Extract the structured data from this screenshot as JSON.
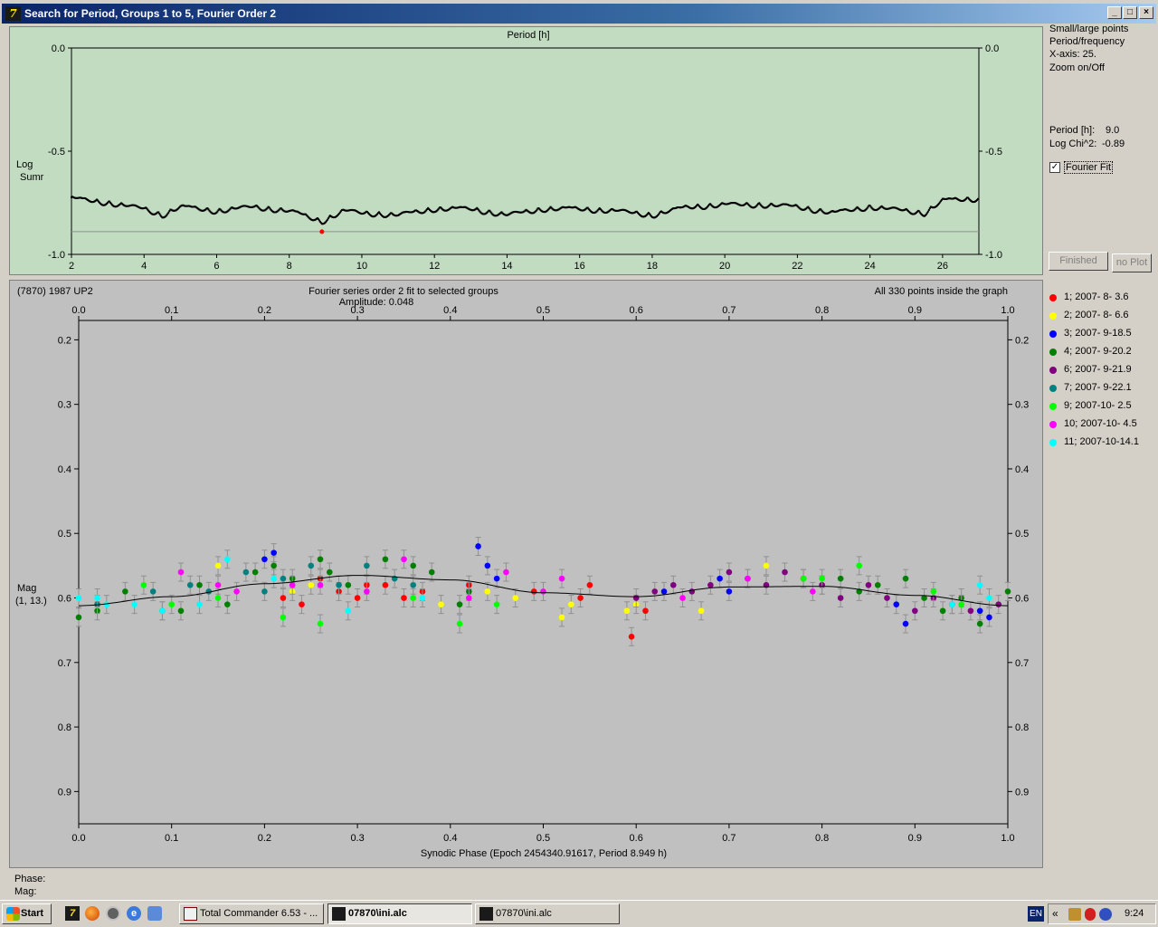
{
  "window": {
    "title": "Search for Period, Groups 1 to 5, Fourier Order 2",
    "min": "_",
    "max": "□",
    "close": "×"
  },
  "periodogram": {
    "xlabel": "Period [h]",
    "ylabel_line1": "Log",
    "ylabel_line2": "Sumr",
    "x_ticks": [
      "2",
      "4",
      "6",
      "8",
      "10",
      "12",
      "14",
      "16",
      "18",
      "20",
      "22",
      "24",
      "26"
    ],
    "y_ticks": [
      "0.0",
      "-0.5",
      "-1.0"
    ]
  },
  "right_panel": {
    "opt1": "Small/large points",
    "opt2": "Period/frequency",
    "opt3": "X-axis: 25.",
    "opt4": "Zoom on/Off",
    "period_label": "Period [h]:",
    "period_value": "9.0",
    "chi_label": "Log Chi^2:",
    "chi_value": "-0.89",
    "checkbox_mark": "✓",
    "fourier_fit": "Fourier Fit",
    "finished": "Finished",
    "no_plot": "no Plot"
  },
  "lightcurve": {
    "object": "(7870) 1987 UP2",
    "fit_title": "Fourier series order 2 fit to selected groups",
    "amplitude": "Amplitude: 0.048",
    "points_note": "All 330 points inside the graph",
    "ylabel_line1": "Mag",
    "ylabel_line2": "(1, 13.)",
    "xlabel": "Synodic Phase (Epoch 2454340.91617, Period 8.949 h)",
    "x_ticks": [
      "0.0",
      "0.1",
      "0.2",
      "0.3",
      "0.4",
      "0.5",
      "0.6",
      "0.7",
      "0.8",
      "0.9",
      "1.0"
    ],
    "y_ticks": [
      "0.2",
      "0.3",
      "0.4",
      "0.5",
      "0.6",
      "0.7",
      "0.8",
      "0.9"
    ]
  },
  "legend": [
    {
      "label": "1; 2007- 8- 3.6",
      "color": "#ff0000"
    },
    {
      "label": "2; 2007- 8- 6.6",
      "color": "#ffff00"
    },
    {
      "label": "3; 2007- 9-18.5",
      "color": "#0000ff"
    },
    {
      "label": "4; 2007- 9-20.2",
      "color": "#008000"
    },
    {
      "label": "6; 2007- 9-21.9",
      "color": "#800080"
    },
    {
      "label": "7; 2007- 9-22.1",
      "color": "#008080"
    },
    {
      "label": "9; 2007-10- 2.5",
      "color": "#00ff00"
    },
    {
      "label": "10; 2007-10- 4.5",
      "color": "#ff00ff"
    },
    {
      "label": "11; 2007-10-14.1",
      "color": "#00ffff"
    }
  ],
  "status": {
    "phase_label": "Phase:",
    "mag_label": "Mag:"
  },
  "taskbar": {
    "start": "Start",
    "task1": "Total Commander 6.53 - ...",
    "task2": "07870\\ini.alc",
    "task3": "07870\\ini.alc",
    "lang": "EN",
    "clock": "9:24",
    "chevron": "«"
  },
  "chart_data": [
    {
      "type": "scatter",
      "title": "",
      "xlabel": "Period [h]",
      "ylabel": "Log Sumr",
      "xlim": [
        2,
        27
      ],
      "ylim": [
        -1.0,
        0.0
      ],
      "x": [
        2,
        3,
        4,
        4.5,
        5,
        6,
        7,
        8,
        8.9,
        9.5,
        10,
        11,
        12,
        13,
        14,
        15,
        16,
        17,
        18,
        19,
        20,
        21,
        22,
        23,
        24,
        25,
        25.5,
        26,
        27
      ],
      "y": [
        -0.72,
        -0.74,
        -0.77,
        -0.8,
        -0.76,
        -0.78,
        -0.76,
        -0.78,
        -0.83,
        -0.78,
        -0.79,
        -0.8,
        -0.77,
        -0.77,
        -0.8,
        -0.77,
        -0.77,
        -0.78,
        -0.8,
        -0.76,
        -0.75,
        -0.75,
        -0.76,
        -0.79,
        -0.76,
        -0.78,
        -0.79,
        -0.73,
        -0.72
      ],
      "best": {
        "x": 8.9,
        "y": -0.89
      },
      "threshold": -0.89
    },
    {
      "type": "scatter",
      "title": "Fourier series order 2 fit to selected groups",
      "xlabel": "Synodic Phase (Epoch 2454340.91617, Period 8.949 h)",
      "ylabel": "Mag",
      "xlim": [
        0,
        1
      ],
      "ylim": [
        0.95,
        0.17
      ],
      "fit": {
        "x": [
          0,
          0.1,
          0.2,
          0.3,
          0.4,
          0.5,
          0.6,
          0.7,
          0.8,
          0.9,
          1.0
        ],
        "y": [
          0.612,
          0.598,
          0.578,
          0.565,
          0.572,
          0.592,
          0.598,
          0.583,
          0.582,
          0.596,
          0.612
        ]
      },
      "series": [
        {
          "name": "1; 2007- 8- 3.6",
          "x": [
            0.22,
            0.24,
            0.26,
            0.28,
            0.3,
            0.31,
            0.33,
            0.35,
            0.37,
            0.42,
            0.49,
            0.54,
            0.55,
            0.595,
            0.61
          ],
          "y": [
            0.6,
            0.61,
            0.57,
            0.59,
            0.6,
            0.58,
            0.58,
            0.6,
            0.59,
            0.58,
            0.59,
            0.6,
            0.58,
            0.66,
            0.62
          ]
        },
        {
          "name": "2; 2007- 8- 6.6",
          "x": [
            0.15,
            0.23,
            0.25,
            0.39,
            0.44,
            0.47,
            0.52,
            0.53,
            0.59,
            0.6,
            0.67,
            0.74,
            0.78
          ],
          "y": [
            0.55,
            0.59,
            0.58,
            0.61,
            0.59,
            0.6,
            0.63,
            0.61,
            0.62,
            0.61,
            0.62,
            0.55,
            0.57
          ]
        },
        {
          "name": "3; 2007- 9-18.5",
          "x": [
            0.2,
            0.21,
            0.43,
            0.44,
            0.45,
            0.63,
            0.69,
            0.7,
            0.88,
            0.89,
            0.97,
            0.98
          ],
          "y": [
            0.54,
            0.53,
            0.52,
            0.55,
            0.57,
            0.59,
            0.57,
            0.59,
            0.61,
            0.64,
            0.62,
            0.63
          ]
        },
        {
          "name": "4; 2007- 9-20.2",
          "x": [
            0.0,
            0.02,
            0.05,
            0.09,
            0.11,
            0.13,
            0.16,
            0.19,
            0.21,
            0.23,
            0.26,
            0.27,
            0.29,
            0.33,
            0.36,
            0.38,
            0.41,
            0.42,
            0.8,
            0.82,
            0.84,
            0.86,
            0.89,
            0.91,
            0.93,
            0.95,
            0.97,
            1.0
          ],
          "y": [
            0.63,
            0.62,
            0.59,
            0.62,
            0.62,
            0.58,
            0.61,
            0.56,
            0.55,
            0.57,
            0.54,
            0.56,
            0.58,
            0.54,
            0.55,
            0.56,
            0.61,
            0.59,
            0.58,
            0.57,
            0.59,
            0.58,
            0.57,
            0.6,
            0.62,
            0.6,
            0.64,
            0.59
          ]
        },
        {
          "name": "6; 2007- 9-21.9",
          "x": [
            0.6,
            0.62,
            0.64,
            0.66,
            0.68,
            0.7,
            0.72,
            0.74,
            0.76,
            0.78,
            0.8,
            0.82,
            0.85,
            0.87,
            0.9,
            0.92,
            0.94,
            0.96,
            0.99
          ],
          "y": [
            0.6,
            0.59,
            0.58,
            0.59,
            0.58,
            0.56,
            0.57,
            0.58,
            0.56,
            0.57,
            0.58,
            0.6,
            0.58,
            0.6,
            0.62,
            0.6,
            0.61,
            0.62,
            0.61
          ]
        },
        {
          "name": "7; 2007- 9-22.1",
          "x": [
            0.02,
            0.08,
            0.12,
            0.14,
            0.18,
            0.2,
            0.22,
            0.25,
            0.28,
            0.31,
            0.34,
            0.36
          ],
          "y": [
            0.61,
            0.59,
            0.58,
            0.59,
            0.56,
            0.59,
            0.57,
            0.55,
            0.58,
            0.55,
            0.57,
            0.58
          ]
        },
        {
          "name": "9; 2007-10- 2.5",
          "x": [
            0.07,
            0.1,
            0.15,
            0.22,
            0.26,
            0.36,
            0.41,
            0.45,
            0.78,
            0.8,
            0.84,
            0.92,
            0.95
          ],
          "y": [
            0.58,
            0.61,
            0.6,
            0.63,
            0.64,
            0.6,
            0.64,
            0.61,
            0.57,
            0.57,
            0.55,
            0.59,
            0.61
          ]
        },
        {
          "name": "10; 2007-10- 4.5",
          "x": [
            0.11,
            0.15,
            0.17,
            0.23,
            0.26,
            0.31,
            0.35,
            0.42,
            0.46,
            0.5,
            0.52,
            0.65,
            0.72,
            0.79
          ],
          "y": [
            0.56,
            0.58,
            0.59,
            0.58,
            0.58,
            0.59,
            0.54,
            0.6,
            0.56,
            0.59,
            0.57,
            0.6,
            0.57,
            0.59
          ]
        },
        {
          "name": "11; 2007-10-14.1",
          "x": [
            0.0,
            0.02,
            0.03,
            0.06,
            0.09,
            0.13,
            0.16,
            0.21,
            0.29,
            0.37,
            0.94,
            0.97,
            0.98
          ],
          "y": [
            0.6,
            0.6,
            0.61,
            0.61,
            0.62,
            0.61,
            0.54,
            0.57,
            0.62,
            0.6,
            0.61,
            0.58,
            0.6
          ]
        }
      ]
    }
  ]
}
